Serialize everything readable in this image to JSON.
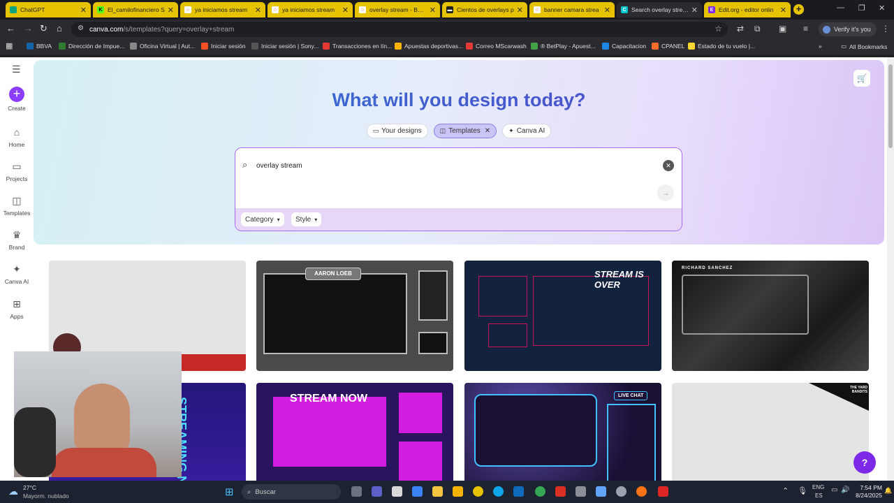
{
  "browser": {
    "tabs": [
      {
        "label": "ChatGPT",
        "color": "#10a37f"
      },
      {
        "label": "El_camilofinanciero S",
        "color": "#53fc18"
      },
      {
        "label": "ya iniciamos stream",
        "color": "#ea4335"
      },
      {
        "label": "ya iniciamos stream",
        "color": "#ea4335"
      },
      {
        "label": "overlay stream - Búsq",
        "color": "#ea4335"
      },
      {
        "label": "Cientos de overlays p",
        "color": "#222222"
      },
      {
        "label": "banner camara strea",
        "color": "#ea4335"
      },
      {
        "label": "Search overlay stream",
        "color": "#00c4cc"
      },
      {
        "label": "Edit.org - editor onlin",
        "color": "#7d2ae8"
      }
    ],
    "active_tab_index": 7,
    "address": {
      "host": "canva.com",
      "path": "/s/templates?query=overlay+stream"
    },
    "verify_label": "Verify it's you",
    "bookmarks": [
      {
        "label": "BBVA",
        "color": "#1464a5"
      },
      {
        "label": "Dirección de Impue...",
        "color": "#2e7d32"
      },
      {
        "label": "Oficina Virtual | Aut...",
        "color": "#888888"
      },
      {
        "label": "Iniciar sesión",
        "color": "#f25022"
      },
      {
        "label": "Iniciar sesión | Sony...",
        "color": "#555555"
      },
      {
        "label": "Transacciones en lín...",
        "color": "#e53935"
      },
      {
        "label": "Apuestas deportivas...",
        "color": "#ffb300"
      },
      {
        "label": "Correo MScarwash",
        "color": "#e53935"
      },
      {
        "label": "® BetPlay - Apuest...",
        "color": "#43a047"
      },
      {
        "label": "Capacitacion",
        "color": "#1e88e5"
      },
      {
        "label": "CPANEL",
        "color": "#ff6c2c"
      },
      {
        "label": "Estado de tu vuelo |...",
        "color": "#fdd835"
      }
    ],
    "all_bookmarks_label": "All Bookmarks"
  },
  "canva": {
    "rail": [
      {
        "label": "Create",
        "icon": "plus-icon"
      },
      {
        "label": "Home",
        "icon": "home-icon"
      },
      {
        "label": "Projects",
        "icon": "folder-icon"
      },
      {
        "label": "Templates",
        "icon": "templates-icon"
      },
      {
        "label": "Brand",
        "icon": "brand-icon"
      },
      {
        "label": "Canva AI",
        "icon": "sparkle-icon"
      },
      {
        "label": "Apps",
        "icon": "apps-icon"
      }
    ],
    "hero_title": "What will you design today?",
    "pills": {
      "your_designs": "Your designs",
      "templates": "Templates",
      "canva_ai": "Canva AI"
    },
    "search": {
      "value": "overlay stream"
    },
    "filters": {
      "category": "Category",
      "style": "Style"
    },
    "templates": [
      {
        "caption": "",
        "bg": "#e4e4e4"
      },
      {
        "caption": "AARON LOEB",
        "bg": "#4a4a4a"
      },
      {
        "caption": "STREAM IS OVER",
        "bg": "#13233d"
      },
      {
        "caption": "RICHARD SANCHEZ",
        "bg": "#1a1a1a"
      },
      {
        "caption": "STREAMING NOW",
        "bg": "#23177a"
      },
      {
        "caption": "STREAM NOW",
        "bg": "#2a145e"
      },
      {
        "caption": "LIVE CHAT",
        "bg": "#2a1c5a"
      },
      {
        "caption": "THE YARD BANDITS",
        "bg": "#e4e4e4"
      }
    ],
    "help_label": "?"
  },
  "taskbar": {
    "weather_temp": "27°C",
    "weather_desc": "Mayorm. nublado",
    "search_label": "Buscar",
    "lang_top": "ENG",
    "lang_bottom": "ES",
    "time": "7:54 PM",
    "date": "8/24/2025"
  }
}
